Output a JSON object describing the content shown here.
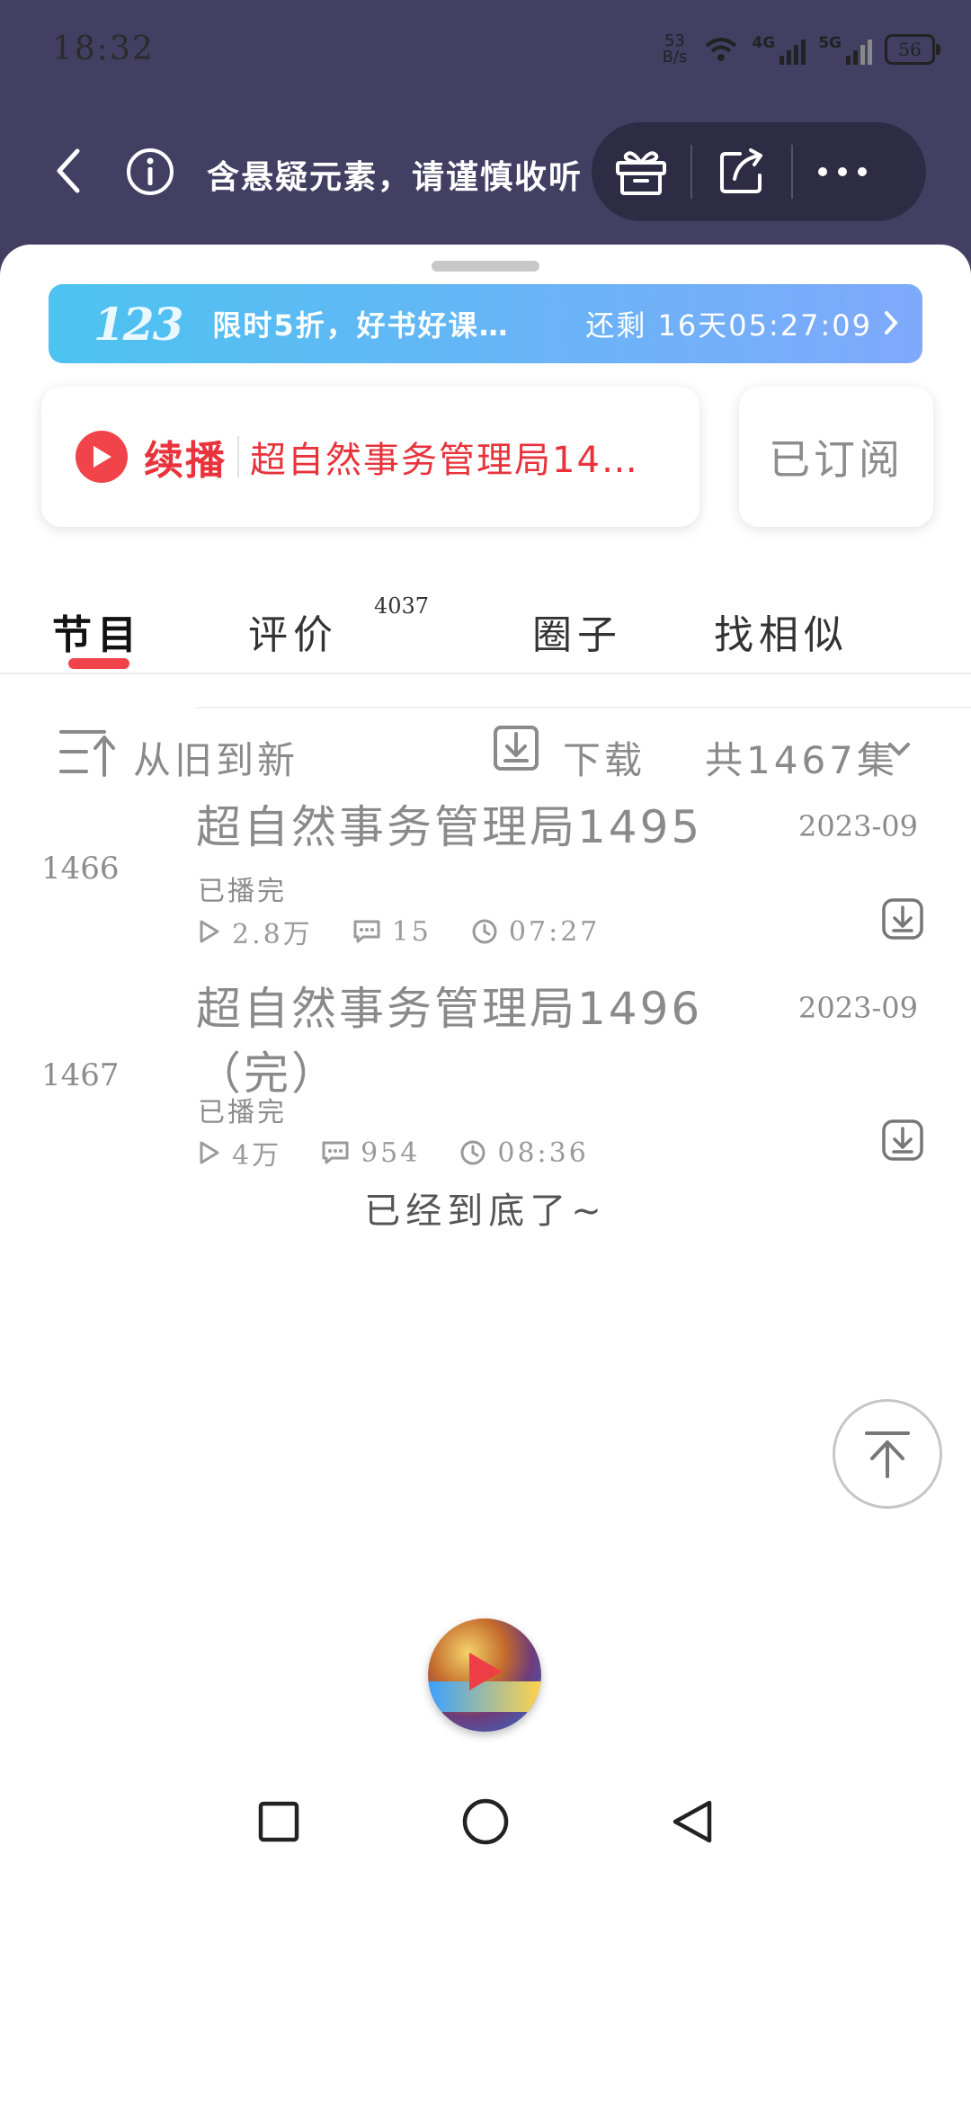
{
  "status_bar": {
    "time": "18:32",
    "net_speed_value": "53",
    "net_speed_unit": "B/s",
    "signal_1": "4G",
    "signal_2": "5G",
    "battery": "56"
  },
  "header": {
    "warning_text": "含悬疑元素，请谨慎收听",
    "icons": [
      "back-icon",
      "info-icon",
      "gift-icon",
      "share-icon",
      "more-icon"
    ]
  },
  "promo": {
    "logo": "123",
    "text": "限时5折，好书好课…",
    "countdown": "还剩 16天05:27:09"
  },
  "resume": {
    "label": "续播",
    "episode_title": "超自然事务管理局14…",
    "subscribed_label": "已订阅"
  },
  "tabs": [
    {
      "label": "节目",
      "active": true
    },
    {
      "label": "评价",
      "badge": "4037"
    },
    {
      "label": "圈子"
    },
    {
      "label": "找相似"
    }
  ],
  "toolbar": {
    "sort_label": "从旧到新",
    "download_label": "下载",
    "total_label": "共1467集"
  },
  "episodes": [
    {
      "index": "1466",
      "title": "超自然事务管理局1495",
      "date": "2023-09",
      "status": "已播完",
      "plays": "2.8万",
      "comments": "15",
      "duration": "07:27"
    },
    {
      "index": "1467",
      "title": "超自然事务管理局1496（完）",
      "date": "2023-09",
      "status": "已播完",
      "plays": "4万",
      "comments": "954",
      "duration": "08:36"
    }
  ],
  "end_text": "已经到底了~",
  "colors": {
    "accent_red": "#f0434a",
    "header_bg": "#433f63",
    "promo_blue": "#4cc3f0"
  }
}
